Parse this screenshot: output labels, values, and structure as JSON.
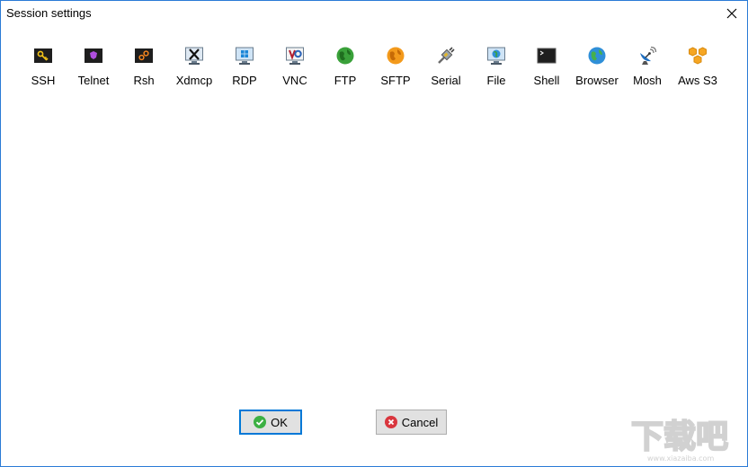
{
  "window": {
    "title": "Session settings"
  },
  "session_types": [
    {
      "key": "ssh",
      "label": "SSH",
      "icon": "key-icon"
    },
    {
      "key": "telnet",
      "label": "Telnet",
      "icon": "telnet-icon"
    },
    {
      "key": "rsh",
      "label": "Rsh",
      "icon": "rsh-icon"
    },
    {
      "key": "xdmcp",
      "label": "Xdmcp",
      "icon": "x-monitor-icon"
    },
    {
      "key": "rdp",
      "label": "RDP",
      "icon": "windows-monitor-icon"
    },
    {
      "key": "vnc",
      "label": "VNC",
      "icon": "vnc-icon"
    },
    {
      "key": "ftp",
      "label": "FTP",
      "icon": "green-globe-icon"
    },
    {
      "key": "sftp",
      "label": "SFTP",
      "icon": "orange-globe-icon"
    },
    {
      "key": "serial",
      "label": "Serial",
      "icon": "serial-plug-icon"
    },
    {
      "key": "file",
      "label": "File",
      "icon": "file-monitor-icon"
    },
    {
      "key": "shell",
      "label": "Shell",
      "icon": "terminal-icon"
    },
    {
      "key": "browser",
      "label": "Browser",
      "icon": "earth-globe-icon"
    },
    {
      "key": "mosh",
      "label": "Mosh",
      "icon": "satellite-dish-icon"
    },
    {
      "key": "awss3",
      "label": "Aws S3",
      "icon": "cubes-icon"
    }
  ],
  "buttons": {
    "ok_label": "OK",
    "cancel_label": "Cancel"
  },
  "colors": {
    "window_border": "#2b7bd6",
    "button_focus": "#0078d7",
    "ok_check": "#3cb043",
    "cancel_x": "#d9363e"
  },
  "watermark": {
    "line1": "下载吧",
    "line2": "www.xiazaiba.com"
  }
}
